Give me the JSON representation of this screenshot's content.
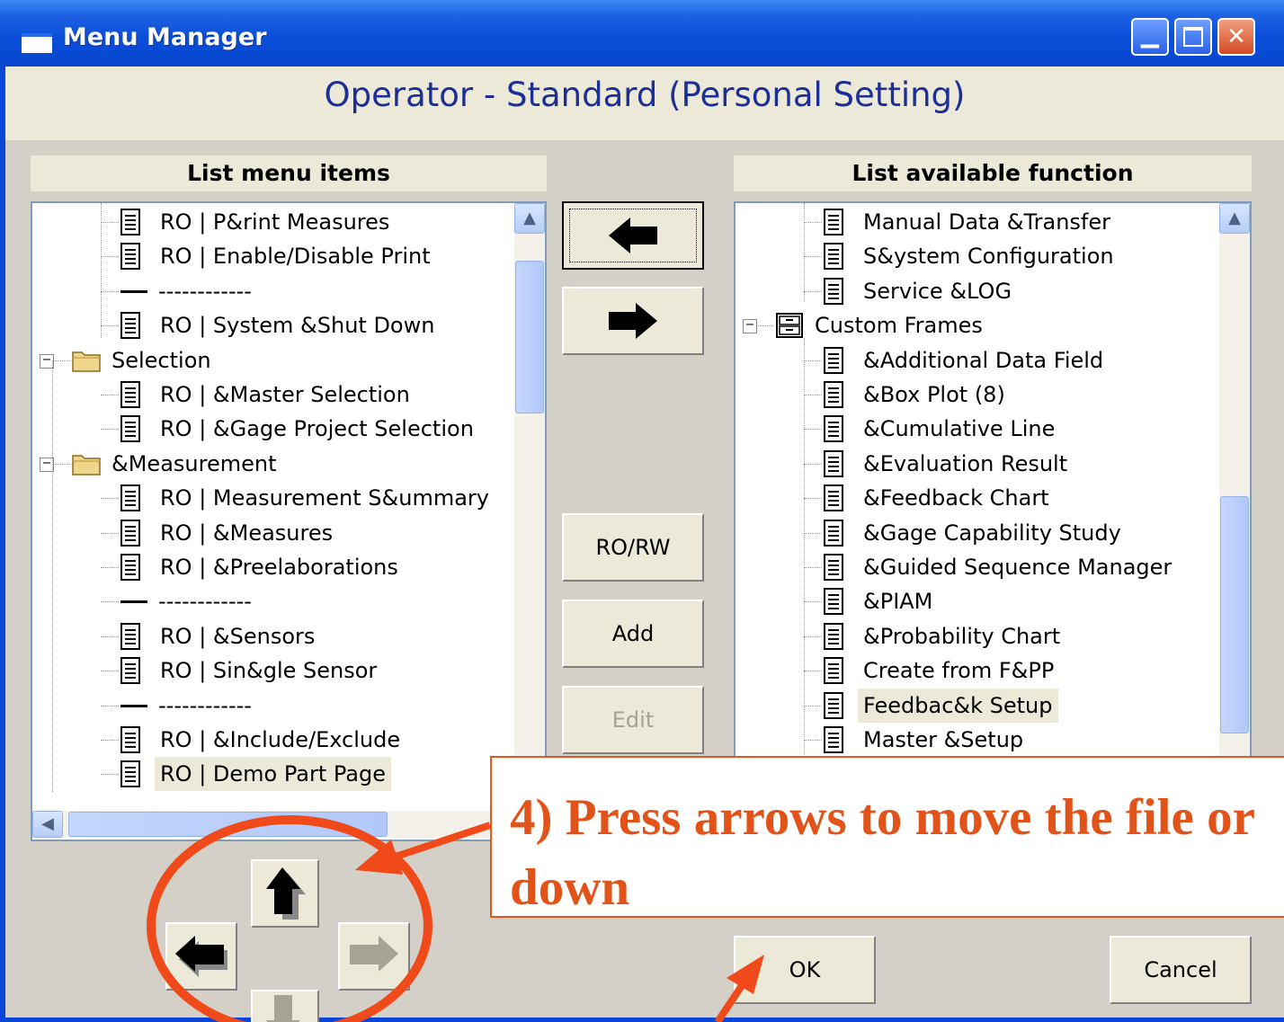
{
  "window": {
    "title": "Menu Manager"
  },
  "header": {
    "title": "Operator - Standard (Personal Setting)"
  },
  "left_panel": {
    "heading": "List menu items",
    "items": [
      {
        "type": "item",
        "label": "RO | P&rint Measures"
      },
      {
        "type": "item",
        "label": "RO | Enable/Disable Print"
      },
      {
        "type": "separator",
        "label": "------------"
      },
      {
        "type": "item",
        "label": "RO | System &Shut Down"
      },
      {
        "type": "folder",
        "label": "Selection"
      },
      {
        "type": "item",
        "label": "RO | &Master Selection"
      },
      {
        "type": "item",
        "label": "RO | &Gage Project Selection"
      },
      {
        "type": "folder",
        "label": "&Measurement"
      },
      {
        "type": "item",
        "label": "RO | Measurement S&ummary"
      },
      {
        "type": "item",
        "label": "RO | &Measures"
      },
      {
        "type": "item",
        "label": "RO | &Preelaborations"
      },
      {
        "type": "separator",
        "label": "------------"
      },
      {
        "type": "item",
        "label": "RO | &Sensors"
      },
      {
        "type": "item",
        "label": "RO | Sin&gle Sensor"
      },
      {
        "type": "separator",
        "label": "------------"
      },
      {
        "type": "item",
        "label": "RO | &Include/Exclude"
      },
      {
        "type": "item",
        "label": "RO | Demo Part Page",
        "selected": true
      }
    ]
  },
  "right_panel": {
    "heading": "List available function",
    "items": [
      {
        "type": "item",
        "label": "Manual Data &Transfer"
      },
      {
        "type": "item",
        "label": "S&ystem Configuration"
      },
      {
        "type": "item",
        "label": "Service &LOG"
      },
      {
        "type": "cabinet",
        "label": "Custom Frames"
      },
      {
        "type": "item",
        "label": "&Additional Data Field"
      },
      {
        "type": "item",
        "label": "&Box Plot (8)"
      },
      {
        "type": "item",
        "label": "&Cumulative Line"
      },
      {
        "type": "item",
        "label": "&Evaluation Result"
      },
      {
        "type": "item",
        "label": "&Feedback Chart"
      },
      {
        "type": "item",
        "label": "&Gage Capability Study"
      },
      {
        "type": "item",
        "label": "&Guided Sequence Manager"
      },
      {
        "type": "item",
        "label": "&PIAM"
      },
      {
        "type": "item",
        "label": "&Probability Chart"
      },
      {
        "type": "item",
        "label": "Create from F&PP"
      },
      {
        "type": "item",
        "label": "Feedbac&k Setup",
        "selected": true
      },
      {
        "type": "item",
        "label": "Master &Setup"
      }
    ]
  },
  "buttons": {
    "ro_rw": "RO/RW",
    "add": "Add",
    "edit": "Edit",
    "ok": "OK",
    "cancel": "Cancel"
  },
  "annotation": {
    "text": "4) Press arrows to move the file or down",
    "color": "#e2531a"
  },
  "colors": {
    "title_bar": "#0a4fd8",
    "dialog_bg": "#d4d0c8",
    "header_text": "#1c2f96"
  },
  "icons": {
    "move_left": "arrow-left-icon",
    "move_right": "arrow-right-icon",
    "order_up": "arrow-up-icon",
    "order_down": "arrow-down-icon"
  }
}
